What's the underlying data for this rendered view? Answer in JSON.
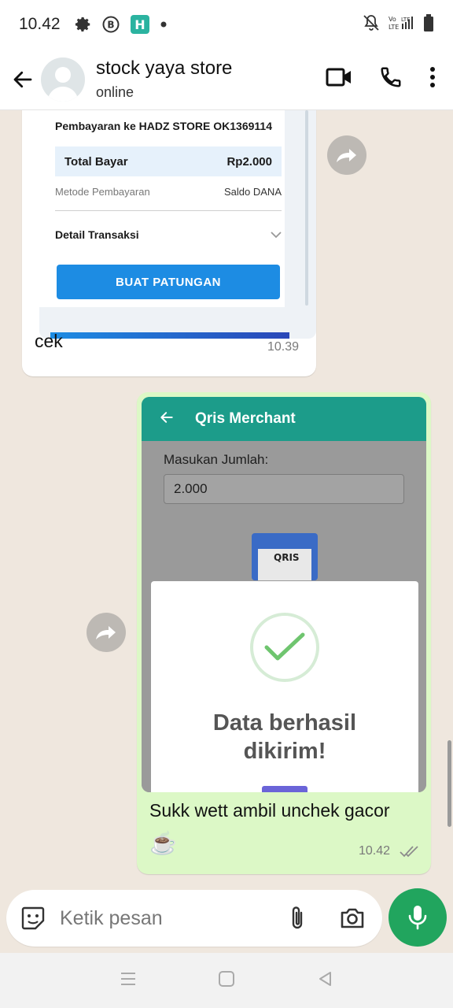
{
  "status_bar": {
    "time": "10.42",
    "icons": [
      "gear-icon",
      "b-badge-icon",
      "h-app-icon",
      "dot-icon",
      "mute-bell-icon",
      "volte-icon",
      "signal-icon",
      "battery-icon"
    ],
    "volte_label": "Vo LTE",
    "lte_label": "LTE"
  },
  "header": {
    "contact_name": "stock yaya store",
    "contact_status": "online"
  },
  "messages": [
    {
      "direction": "incoming",
      "screenshot": {
        "title": "Pembayaran ke HADZ STORE OK1369114",
        "total_label": "Total Bayar",
        "total_value": "Rp2.000",
        "method_label": "Metode Pembayaran",
        "method_value": "Saldo DANA",
        "detail_label": "Detail Transaksi",
        "button_label": "BUAT PATUNGAN"
      },
      "text": "cek",
      "time": "10.39"
    },
    {
      "direction": "outgoing",
      "screenshot": {
        "app_title": "Qris Merchant",
        "amount_label": "Masukan Jumlah:",
        "amount_value": "2.000",
        "qris_logo": "QRIS",
        "modal_title_line1": "Data berhasil",
        "modal_title_line2": "dikirim!"
      },
      "text": "Sukk wett ambil unchek gacor",
      "emoji": "☕",
      "time": "10.42"
    }
  ],
  "composer": {
    "placeholder": "Ketik pesan"
  },
  "colors": {
    "chat_bg": "#efe7de",
    "outgoing_bubble": "#dcf8c6",
    "accent_green": "#21a55e",
    "dana_blue": "#1d8ce3",
    "qris_teal": "#1c9c8a"
  }
}
